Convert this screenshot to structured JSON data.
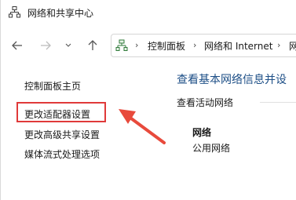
{
  "window": {
    "title": "网络和共享中心"
  },
  "navbar": {
    "breadcrumb": [
      "控制面板",
      "网络和 Internet",
      "网"
    ]
  },
  "sidebar": {
    "items": [
      {
        "label": "控制面板主页"
      },
      {
        "label": "更改适配器设置"
      },
      {
        "label": "更改高级共享设置"
      },
      {
        "label": "媒体流式处理选项"
      }
    ]
  },
  "main": {
    "title": "查看基本网络信息并设",
    "section_label": "查看活动网络",
    "network_name": "网络",
    "network_type": "公用网络"
  },
  "colors": {
    "highlight": "#e03a3a",
    "title": "#1c4e86"
  }
}
